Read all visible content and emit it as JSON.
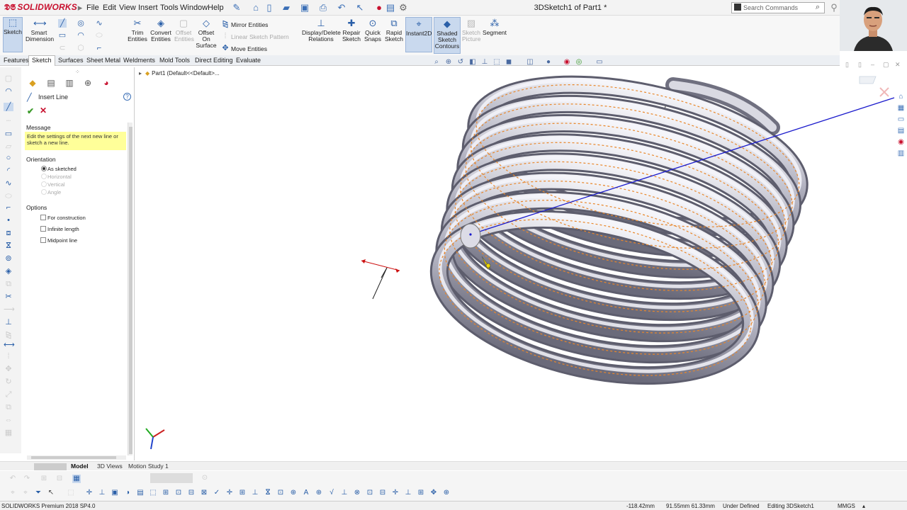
{
  "app": {
    "logo_text": "SOLIDWORKS",
    "document_title": "3DSketch1 of Part1 *"
  },
  "menu": [
    "File",
    "Edit",
    "View",
    "Insert",
    "Tools",
    "Window",
    "Help"
  ],
  "search": {
    "placeholder": "Search Commands"
  },
  "command_manager": {
    "sketch": "Sketch",
    "smart_dimension": "Smart Dimension",
    "trim_entities": "Trim Entities",
    "convert_entities": "Convert Entities",
    "offset_entities": "Offset Entities",
    "offset_on_surface": "Offset On Surface",
    "mirror_entities": "Mirror Entities",
    "linear_sketch_pattern": "Linear Sketch Pattern",
    "move_entities": "Move Entities",
    "display_delete_relations": "Display/Delete Relations",
    "repair_sketch": "Repair Sketch",
    "quick_snaps": "Quick Snaps",
    "rapid_sketch": "Rapid Sketch",
    "instant2d": "Instant2D",
    "shaded_sketch_contours": "Shaded Sketch Contours",
    "sketch_picture": "Sketch Picture",
    "segment": "Segment"
  },
  "tabs": [
    "Features",
    "Sketch",
    "Surfaces",
    "Sheet Metal",
    "Weldments",
    "Mold Tools",
    "Direct Editing",
    "Evaluate"
  ],
  "active_tab": "Sketch",
  "property_manager": {
    "title": "Insert Line",
    "message_title": "Message",
    "message": "Edit the settings of the next new line or sketch a new line.",
    "orientation_title": "Orientation",
    "orientation_options": [
      {
        "label": "As sketched",
        "selected": true,
        "enabled": true
      },
      {
        "label": "Horizontal",
        "selected": false,
        "enabled": false
      },
      {
        "label": "Vertical",
        "selected": false,
        "enabled": false
      },
      {
        "label": "Angle",
        "selected": false,
        "enabled": false
      }
    ],
    "options_title": "Options",
    "options": [
      {
        "label": "For construction",
        "checked": false
      },
      {
        "label": "Infinite length",
        "checked": false
      },
      {
        "label": "Midpoint line",
        "checked": false
      }
    ]
  },
  "feature_tree": {
    "root": "Part1  (Default<<Default>..."
  },
  "bottom_tabs": [
    "Model",
    "3D Views",
    "Motion Study 1"
  ],
  "active_bottom_tab": "Model",
  "status_bar": {
    "product": "SOLIDWORKS Premium 2018 SP4.0",
    "coord_x": "-118.42mm",
    "coord_yz": "91.55mm 61.33mm",
    "sketch_state": "Under Defined",
    "editing": "Editing 3DSketch1",
    "units": "MMGS"
  },
  "colors": {
    "brand_red": "#c8102e",
    "accent_blue": "#2a5fa8",
    "helix_orange": "#e8862a",
    "sketch_line_blue": "#1a1acc",
    "message_yellow": "#ffff99"
  }
}
